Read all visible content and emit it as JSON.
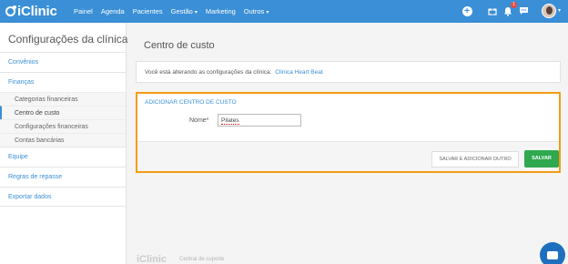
{
  "app": {
    "logo_text": "iClinic"
  },
  "nav": {
    "items": [
      "Painel",
      "Agenda",
      "Pacientes",
      "Gestão",
      "Marketing",
      "Outros"
    ],
    "dropdown_caret": "▾",
    "notification_count": "1"
  },
  "sidebar": {
    "title": "Configurações da clínica",
    "sections": {
      "convenios": "Convênios",
      "financas": "Finanças",
      "equipe": "Equipe",
      "regras": "Regras de repasse",
      "exportar": "Exportar dados"
    },
    "finance_items": [
      "Categorias financeiras",
      "Centro de custo",
      "Configurações financeiras",
      "Contas bancárias"
    ]
  },
  "main": {
    "page_title": "Centro de custo",
    "info_text": "Você está alterando as configurações da clínica:",
    "clinic_name": "Clinica Heart Beat",
    "panel_title": "ADICIONAR CENTRO DE CUSTO",
    "name_label": "Nome*",
    "name_value": "Pilates",
    "btn_save_add": "SALVAR E ADICIONAR OUTRO",
    "btn_save": "SALVAR"
  },
  "footer": {
    "logo_text": "iClinic",
    "link": "Central de suporte"
  },
  "colors": {
    "brand": "#3a8fd6",
    "highlight": "#f39c12",
    "save": "#2fa84f"
  }
}
